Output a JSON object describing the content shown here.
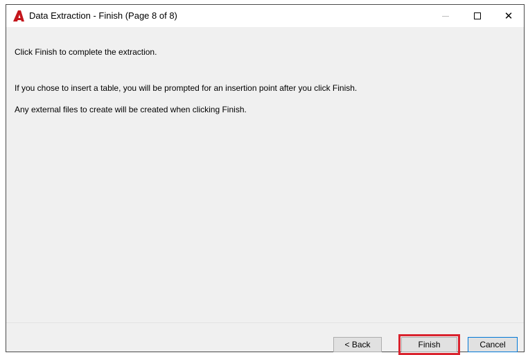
{
  "window": {
    "title": "Data Extraction - Finish (Page 8 of 8)",
    "app_icon": "autocad-logo-icon"
  },
  "title_buttons": {
    "minimize": "minimize-icon",
    "maximize": "maximize-icon",
    "close_glyph": "✕"
  },
  "content": {
    "line1": "Click Finish to complete the extraction.",
    "line2": "If you chose to insert a table, you will be prompted for an insertion point after you click Finish.",
    "line3": "Any external files to create will be created when clicking Finish."
  },
  "footer": {
    "back_label": "< Back",
    "finish_label": "Finish",
    "cancel_label": "Cancel"
  },
  "colors": {
    "highlight": "#d9232e",
    "logo": "#c4161c",
    "default_button_border": "#0078d7"
  }
}
